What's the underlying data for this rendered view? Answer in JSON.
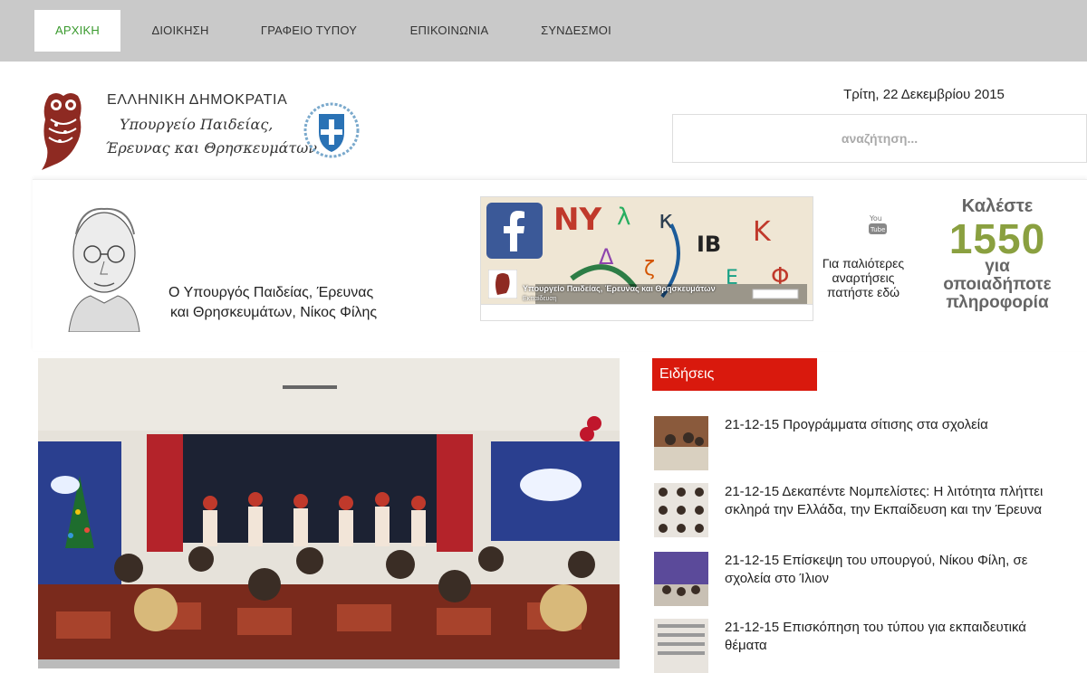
{
  "nav": {
    "items": [
      {
        "label": "ΑΡΧΙΚΗ",
        "active": true
      },
      {
        "label": "ΔΙΟΙΚΗΣΗ",
        "active": false
      },
      {
        "label": "ΓΡΑΦΕΙΟ ΤΥΠΟΥ",
        "active": false
      },
      {
        "label": "ΕΠΙΚΟΙΝΩΝΙΑ",
        "active": false
      },
      {
        "label": "ΣΥΝΔΕΣΜΟΙ",
        "active": false
      }
    ]
  },
  "header": {
    "logo_line1": "ΕΛΛΗΝΙΚΗ ΔΗΜΟΚΡΑΤΙΑ",
    "logo_line2": "Υπουργείο Παιδείας,",
    "logo_line3": "Έρευνας και Θρησκευμάτων",
    "date": "Τρίτη, 22 Δεκεμβρίου 2015",
    "search_placeholder": "αναζήτηση..."
  },
  "banner": {
    "minister_line1": "Ο Υπουργός Παιδείας, Έρευνας",
    "minister_line2": "και Θρησκευμάτων, Νίκος Φίλης",
    "fb_page_name": "Υπουργείο Παιδείας, Έρευνας και Θρησκευμάτων",
    "fb_page_sub": "Εκπαίδευση",
    "older_posts": "Για παλιότερες αναρτήσεις πατήστε εδώ",
    "call_label": "Καλέστε",
    "call_number": "1550",
    "call_sub1": "για",
    "call_sub2": "οποιαδήποτε",
    "call_sub3": "πληροφορία"
  },
  "news": {
    "title": "Ειδήσεις",
    "items": [
      {
        "text": "21-12-15 Προγράμματα σίτισης στα σχολεία"
      },
      {
        "text": "21-12-15 Δεκαπέντε Νομπελίστες: Η λιτότητα πλήττει σκληρά την Ελλάδα, την Εκπαίδευση και την Έρευνα"
      },
      {
        "text": "21-12-15 Επίσκεψη του υπουργού, Νίκου Φίλη, σε σχολεία στο Ίλιον"
      },
      {
        "text": "21-12-15 Επισκόπηση του τύπου για εκπαιδευτικά θέματα"
      }
    ]
  },
  "colors": {
    "nav_bg": "#c9c9c9",
    "nav_active_text": "#3a9a2e",
    "news_header_bg": "#d9190d",
    "call_number": "#8aa040"
  }
}
